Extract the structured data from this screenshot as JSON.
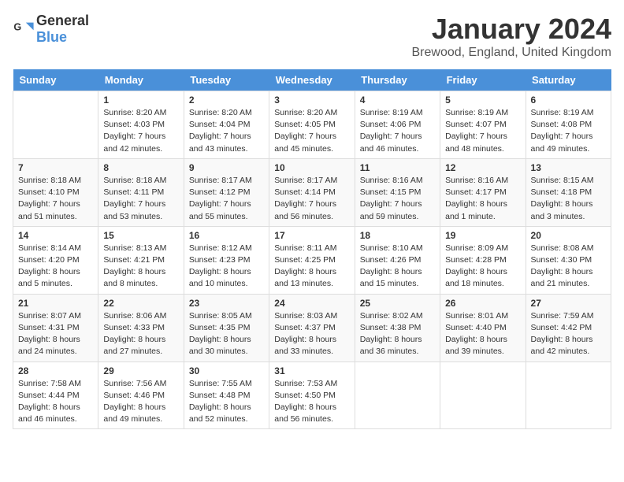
{
  "header": {
    "logo_general": "General",
    "logo_blue": "Blue",
    "month": "January 2024",
    "location": "Brewood, England, United Kingdom"
  },
  "days_of_week": [
    "Sunday",
    "Monday",
    "Tuesday",
    "Wednesday",
    "Thursday",
    "Friday",
    "Saturday"
  ],
  "weeks": [
    [
      {
        "day": "",
        "content": ""
      },
      {
        "day": "1",
        "content": "Sunrise: 8:20 AM\nSunset: 4:03 PM\nDaylight: 7 hours\nand 42 minutes."
      },
      {
        "day": "2",
        "content": "Sunrise: 8:20 AM\nSunset: 4:04 PM\nDaylight: 7 hours\nand 43 minutes."
      },
      {
        "day": "3",
        "content": "Sunrise: 8:20 AM\nSunset: 4:05 PM\nDaylight: 7 hours\nand 45 minutes."
      },
      {
        "day": "4",
        "content": "Sunrise: 8:19 AM\nSunset: 4:06 PM\nDaylight: 7 hours\nand 46 minutes."
      },
      {
        "day": "5",
        "content": "Sunrise: 8:19 AM\nSunset: 4:07 PM\nDaylight: 7 hours\nand 48 minutes."
      },
      {
        "day": "6",
        "content": "Sunrise: 8:19 AM\nSunset: 4:08 PM\nDaylight: 7 hours\nand 49 minutes."
      }
    ],
    [
      {
        "day": "7",
        "content": "Sunrise: 8:18 AM\nSunset: 4:10 PM\nDaylight: 7 hours\nand 51 minutes."
      },
      {
        "day": "8",
        "content": "Sunrise: 8:18 AM\nSunset: 4:11 PM\nDaylight: 7 hours\nand 53 minutes."
      },
      {
        "day": "9",
        "content": "Sunrise: 8:17 AM\nSunset: 4:12 PM\nDaylight: 7 hours\nand 55 minutes."
      },
      {
        "day": "10",
        "content": "Sunrise: 8:17 AM\nSunset: 4:14 PM\nDaylight: 7 hours\nand 56 minutes."
      },
      {
        "day": "11",
        "content": "Sunrise: 8:16 AM\nSunset: 4:15 PM\nDaylight: 7 hours\nand 59 minutes."
      },
      {
        "day": "12",
        "content": "Sunrise: 8:16 AM\nSunset: 4:17 PM\nDaylight: 8 hours\nand 1 minute."
      },
      {
        "day": "13",
        "content": "Sunrise: 8:15 AM\nSunset: 4:18 PM\nDaylight: 8 hours\nand 3 minutes."
      }
    ],
    [
      {
        "day": "14",
        "content": "Sunrise: 8:14 AM\nSunset: 4:20 PM\nDaylight: 8 hours\nand 5 minutes."
      },
      {
        "day": "15",
        "content": "Sunrise: 8:13 AM\nSunset: 4:21 PM\nDaylight: 8 hours\nand 8 minutes."
      },
      {
        "day": "16",
        "content": "Sunrise: 8:12 AM\nSunset: 4:23 PM\nDaylight: 8 hours\nand 10 minutes."
      },
      {
        "day": "17",
        "content": "Sunrise: 8:11 AM\nSunset: 4:25 PM\nDaylight: 8 hours\nand 13 minutes."
      },
      {
        "day": "18",
        "content": "Sunrise: 8:10 AM\nSunset: 4:26 PM\nDaylight: 8 hours\nand 15 minutes."
      },
      {
        "day": "19",
        "content": "Sunrise: 8:09 AM\nSunset: 4:28 PM\nDaylight: 8 hours\nand 18 minutes."
      },
      {
        "day": "20",
        "content": "Sunrise: 8:08 AM\nSunset: 4:30 PM\nDaylight: 8 hours\nand 21 minutes."
      }
    ],
    [
      {
        "day": "21",
        "content": "Sunrise: 8:07 AM\nSunset: 4:31 PM\nDaylight: 8 hours\nand 24 minutes."
      },
      {
        "day": "22",
        "content": "Sunrise: 8:06 AM\nSunset: 4:33 PM\nDaylight: 8 hours\nand 27 minutes."
      },
      {
        "day": "23",
        "content": "Sunrise: 8:05 AM\nSunset: 4:35 PM\nDaylight: 8 hours\nand 30 minutes."
      },
      {
        "day": "24",
        "content": "Sunrise: 8:03 AM\nSunset: 4:37 PM\nDaylight: 8 hours\nand 33 minutes."
      },
      {
        "day": "25",
        "content": "Sunrise: 8:02 AM\nSunset: 4:38 PM\nDaylight: 8 hours\nand 36 minutes."
      },
      {
        "day": "26",
        "content": "Sunrise: 8:01 AM\nSunset: 4:40 PM\nDaylight: 8 hours\nand 39 minutes."
      },
      {
        "day": "27",
        "content": "Sunrise: 7:59 AM\nSunset: 4:42 PM\nDaylight: 8 hours\nand 42 minutes."
      }
    ],
    [
      {
        "day": "28",
        "content": "Sunrise: 7:58 AM\nSunset: 4:44 PM\nDaylight: 8 hours\nand 46 minutes."
      },
      {
        "day": "29",
        "content": "Sunrise: 7:56 AM\nSunset: 4:46 PM\nDaylight: 8 hours\nand 49 minutes."
      },
      {
        "day": "30",
        "content": "Sunrise: 7:55 AM\nSunset: 4:48 PM\nDaylight: 8 hours\nand 52 minutes."
      },
      {
        "day": "31",
        "content": "Sunrise: 7:53 AM\nSunset: 4:50 PM\nDaylight: 8 hours\nand 56 minutes."
      },
      {
        "day": "",
        "content": ""
      },
      {
        "day": "",
        "content": ""
      },
      {
        "day": "",
        "content": ""
      }
    ]
  ]
}
